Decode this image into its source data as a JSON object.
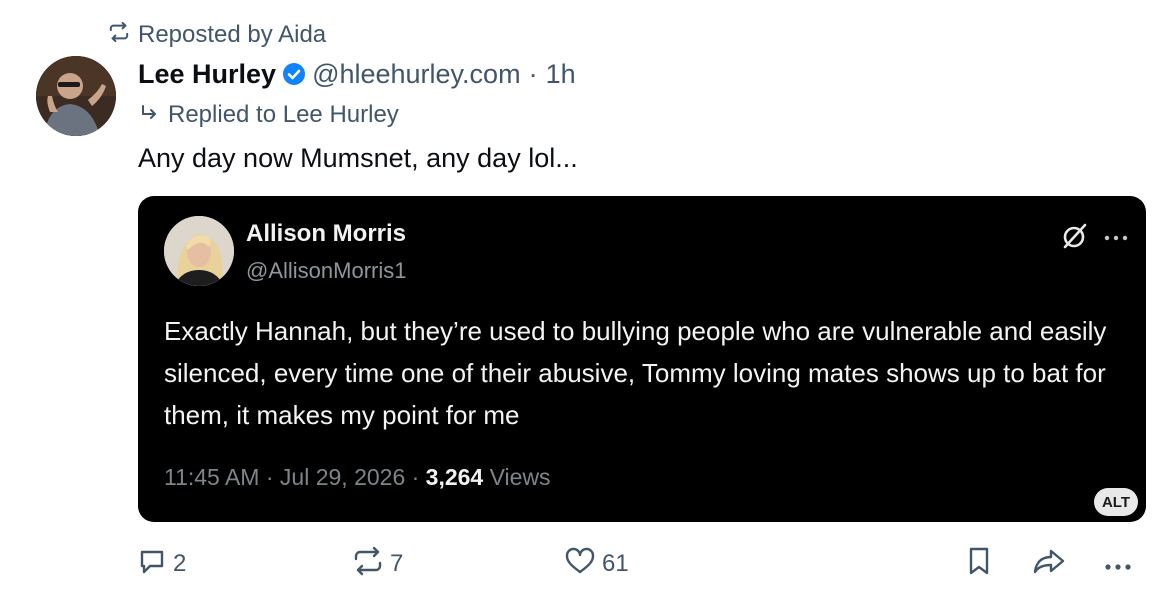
{
  "repost": {
    "icon": "repost-icon",
    "label": "Reposted by Aida"
  },
  "post": {
    "avatar": "user-avatar",
    "author_name": "Lee Hurley",
    "verified": "verified-badge-icon",
    "handle": "@hleehurley.com",
    "separator": "·",
    "time": "1h",
    "reply_to": "Replied to Lee Hurley",
    "text": "Any day now Mumsnet, any day lol..."
  },
  "embed": {
    "name": "Allison Morris",
    "handle": "@AllisonMorris1",
    "text": "Exactly Hannah, but they’re used to bullying people who are vulnerable and easily silenced, every time one of their abusive, Tommy loving mates shows up to bat for them, it makes my point for me",
    "timestamp": "11:45 AM · Jul 29, 2026 ·",
    "views_count": "3,264",
    "views_label": "Views",
    "alt_badge": "ALT",
    "colors": {
      "background": "#000000",
      "text": "#f3f3f3",
      "muted": "#7d858b"
    }
  },
  "actions": {
    "reply_count": "2",
    "repost_count": "7",
    "like_count": "61"
  },
  "colors": {
    "muted": "#42566b",
    "verified": "#1083fe"
  }
}
